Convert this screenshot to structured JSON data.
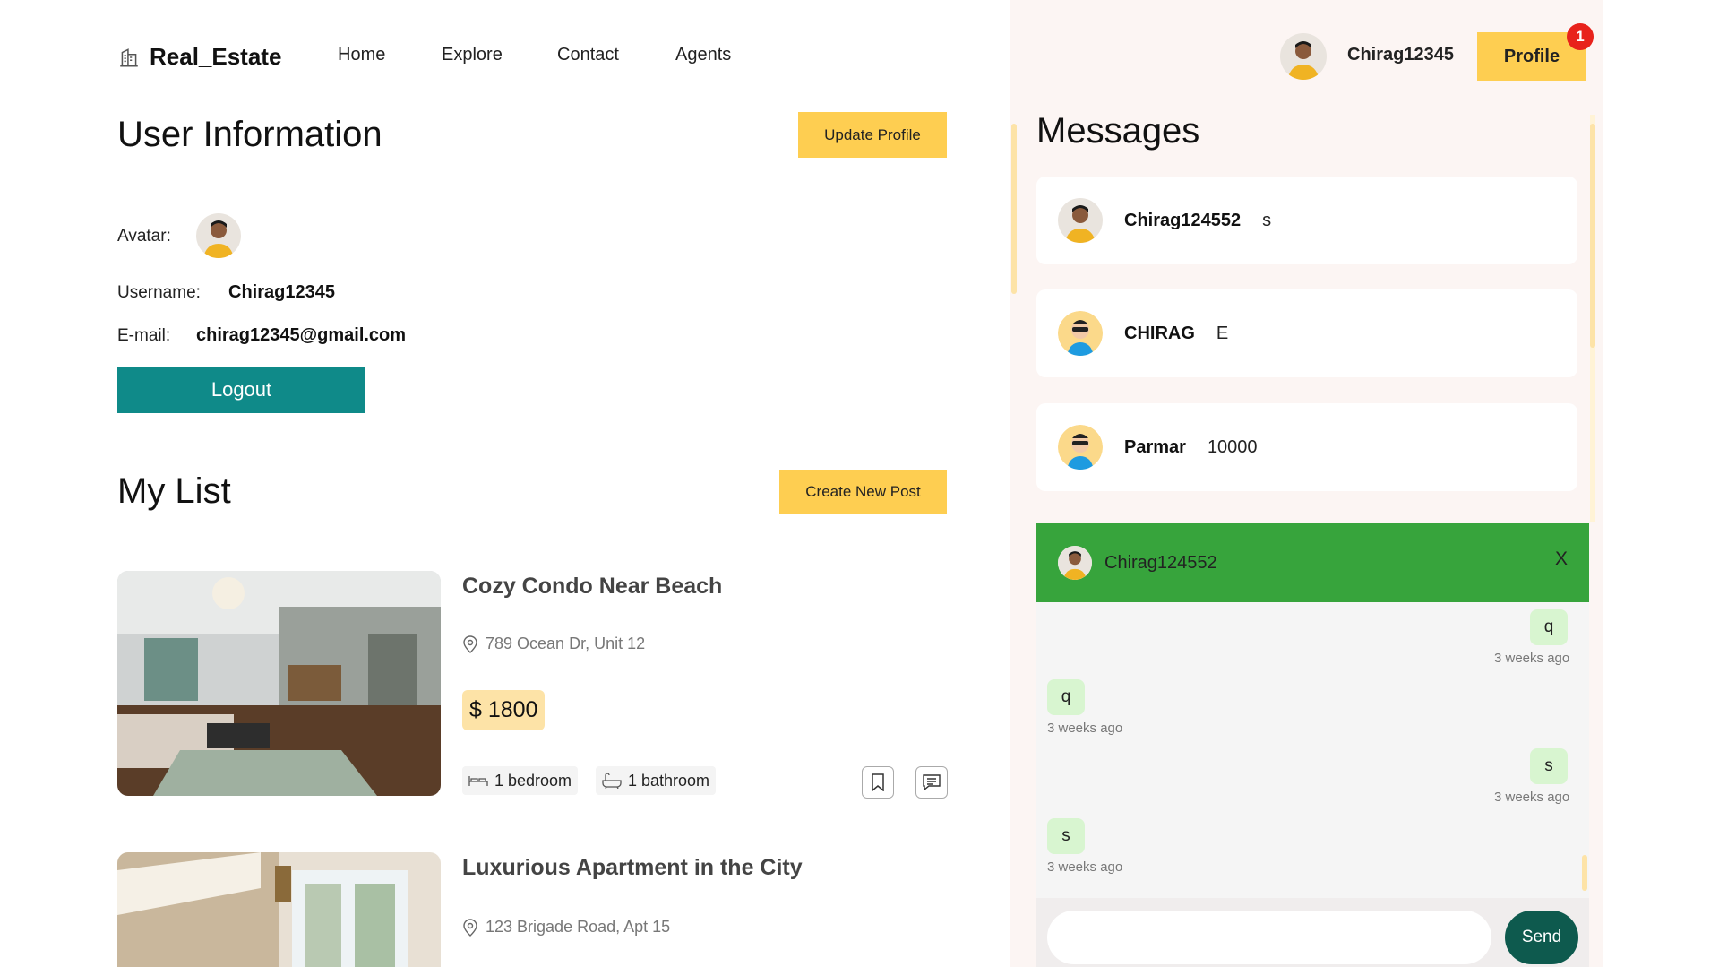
{
  "brand": {
    "name": "Real_Estate",
    "icon": "building-icon"
  },
  "nav": {
    "home": "Home",
    "explore": "Explore",
    "contact": "Contact",
    "agents": "Agents"
  },
  "user_info": {
    "title": "User Information",
    "update_button": "Update Profile",
    "avatar_label": "Avatar:",
    "username_label": "Username:",
    "username_value": "Chirag12345",
    "email_label": "E-mail:",
    "email_value": "chirag12345@gmail.com",
    "logout_button": "Logout"
  },
  "my_list": {
    "title": "My List",
    "create_button": "Create New Post",
    "cards": [
      {
        "title": "Cozy Condo Near Beach",
        "address": "789 Ocean Dr, Unit 12",
        "price": "$ 1800",
        "bedroom": "1 bedroom",
        "bathroom": "1 bathroom"
      },
      {
        "title": "Luxurious Apartment in the City",
        "address": "123 Brigade Road, Apt 15"
      }
    ]
  },
  "header_user": {
    "username": "Chirag12345",
    "profile_button": "Profile",
    "notification_count": "1"
  },
  "messages": {
    "title": "Messages",
    "items": [
      {
        "name": "Chirag124552",
        "last": "s"
      },
      {
        "name": "CHIRAG",
        "last": "E"
      },
      {
        "name": "Parmar",
        "last": "10000"
      }
    ]
  },
  "chat": {
    "name": "Chirag124552",
    "close": "X",
    "messages": [
      {
        "text": "q",
        "time": "3 weeks ago",
        "own": true
      },
      {
        "text": "q",
        "time": "3 weeks ago",
        "own": false
      },
      {
        "text": "s",
        "time": "3 weeks ago",
        "own": true
      },
      {
        "text": "s",
        "time": "3 weeks ago",
        "own": false
      }
    ],
    "send_button": "Send"
  },
  "colors": {
    "accent_yellow": "#fece51",
    "teal": "#0f8a89",
    "chat_green": "#37a43c",
    "send_dark": "#0e5a4e",
    "badge_red": "#e8221b"
  }
}
